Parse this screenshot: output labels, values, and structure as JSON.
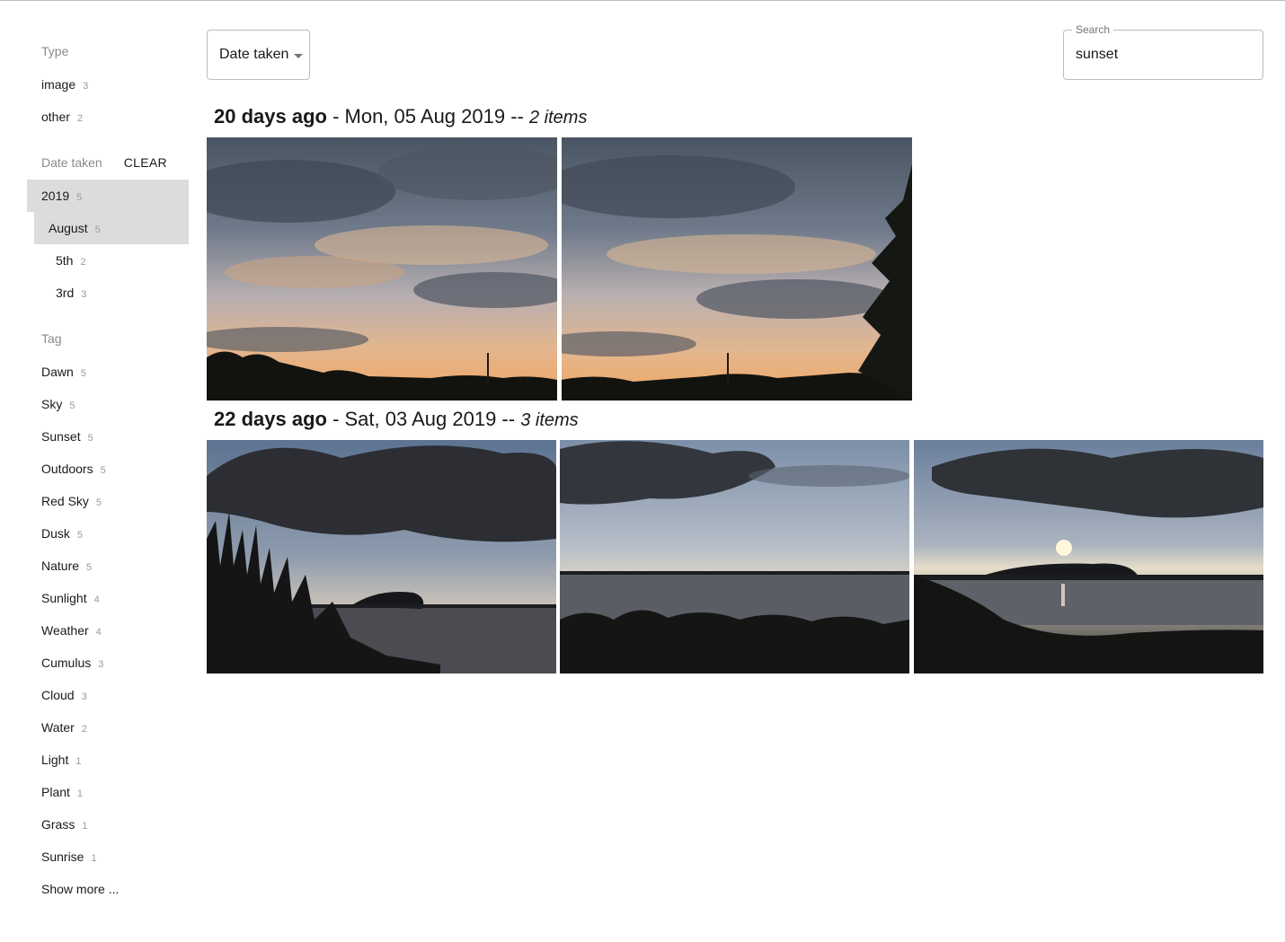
{
  "sidebar": {
    "type_title": "Type",
    "type_items": [
      {
        "label": "image",
        "count": "3"
      },
      {
        "label": "other",
        "count": "2"
      }
    ],
    "date_title": "Date taken",
    "date_clear": "CLEAR",
    "date_items": [
      {
        "label": "2019",
        "count": "5"
      },
      {
        "label": "August",
        "count": "5"
      },
      {
        "label": "5th",
        "count": "2"
      },
      {
        "label": "3rd",
        "count": "3"
      }
    ],
    "tag_title": "Tag",
    "tag_items": [
      {
        "label": "Dawn",
        "count": "5"
      },
      {
        "label": "Sky",
        "count": "5"
      },
      {
        "label": "Sunset",
        "count": "5"
      },
      {
        "label": "Outdoors",
        "count": "5"
      },
      {
        "label": "Red Sky",
        "count": "5"
      },
      {
        "label": "Dusk",
        "count": "5"
      },
      {
        "label": "Nature",
        "count": "5"
      },
      {
        "label": "Sunlight",
        "count": "4"
      },
      {
        "label": "Weather",
        "count": "4"
      },
      {
        "label": "Cumulus",
        "count": "3"
      },
      {
        "label": "Cloud",
        "count": "3"
      },
      {
        "label": "Water",
        "count": "2"
      },
      {
        "label": "Light",
        "count": "1"
      },
      {
        "label": "Plant",
        "count": "1"
      },
      {
        "label": "Grass",
        "count": "1"
      },
      {
        "label": "Sunrise",
        "count": "1"
      }
    ],
    "show_more": "Show more ..."
  },
  "toolbar": {
    "sort_value": "Date taken",
    "search_label": "Search",
    "search_value": "sunset"
  },
  "groups": [
    {
      "relative": "20 days ago",
      "date": " - Mon, 05 Aug 2019 -- ",
      "items": "2 items"
    },
    {
      "relative": "22 days ago",
      "date": " - Sat, 03 Aug 2019 -- ",
      "items": "3 items"
    }
  ],
  "colors": {
    "selected_bg": "#dcdcdc",
    "border": "#bdbdbd",
    "muted": "#8a8a8a"
  }
}
